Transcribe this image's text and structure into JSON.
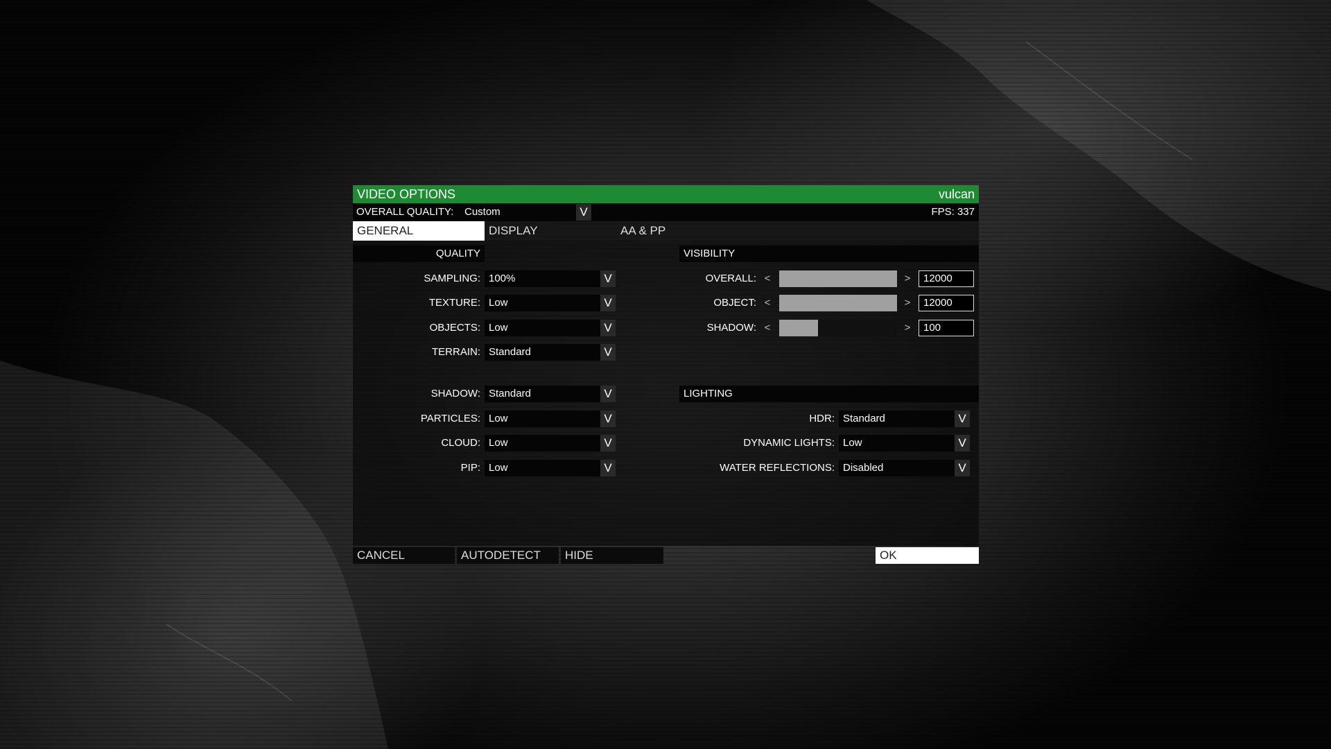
{
  "window": {
    "title": "VIDEO OPTIONS",
    "renderer": "vulcan"
  },
  "overall_quality": {
    "label": "OVERALL QUALITY:",
    "value": "Custom",
    "fps": "FPS: 337"
  },
  "tabs": [
    {
      "label": "GENERAL",
      "active": true
    },
    {
      "label": "DISPLAY",
      "active": false
    },
    {
      "label": "AA & PP",
      "active": false
    }
  ],
  "quality": {
    "heading": "QUALITY",
    "rows": [
      {
        "label": "SAMPLING:",
        "value": "100%"
      },
      {
        "label": "TEXTURE:",
        "value": "Low"
      },
      {
        "label": "OBJECTS:",
        "value": "Low"
      },
      {
        "label": "TERRAIN:",
        "value": "Standard"
      },
      {
        "label": "SHADOW:",
        "value": "Standard"
      },
      {
        "label": "PARTICLES:",
        "value": "Low"
      },
      {
        "label": "CLOUD:",
        "value": "Low"
      },
      {
        "label": "PIP:",
        "value": "Low"
      }
    ]
  },
  "visibility": {
    "heading": "VISIBILITY",
    "dec_symbol": "<",
    "inc_symbol": ">",
    "rows": [
      {
        "label": "OVERALL:",
        "value": "12000",
        "fill_fraction": 1.0
      },
      {
        "label": "OBJECT:",
        "value": "12000",
        "fill_fraction": 1.0
      },
      {
        "label": "SHADOW:",
        "value": "100",
        "fill_fraction": 0.33
      }
    ]
  },
  "lighting": {
    "heading": "LIGHTING",
    "rows": [
      {
        "label": "HDR:",
        "value": "Standard"
      },
      {
        "label": "DYNAMIC LIGHTS:",
        "value": "Low"
      },
      {
        "label": "WATER REFLECTIONS:",
        "value": "Disabled"
      }
    ]
  },
  "dropdown_arrow": "V",
  "buttons": {
    "cancel": "CANCEL",
    "autodetect": "AUTODETECT",
    "hide": "HIDE",
    "ok": "OK"
  },
  "colors": {
    "title_bar": "#1f8a34",
    "slider_fill": "#a0a0a0"
  }
}
